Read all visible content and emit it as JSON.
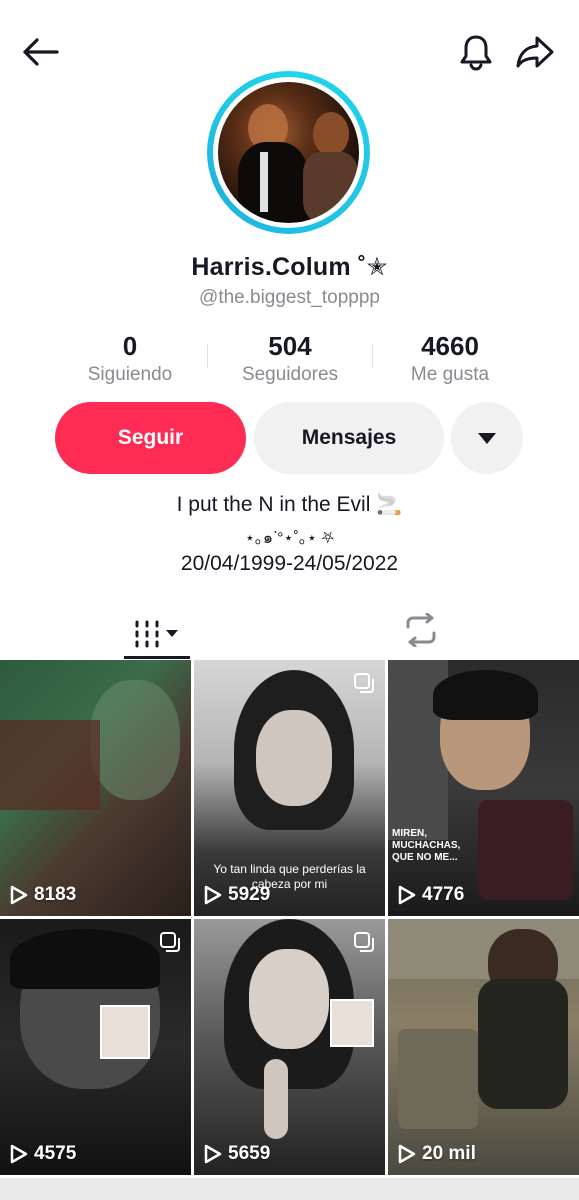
{
  "header": {
    "back_icon": "arrow-left-icon",
    "bell_icon": "bell-icon",
    "share_icon": "share-icon"
  },
  "profile": {
    "name": "Harris.Colum ˚✭",
    "handle": "@the.biggest_topppp"
  },
  "stats": [
    {
      "value": "0",
      "label": "Siguiendo"
    },
    {
      "value": "504",
      "label": "Seguidores"
    },
    {
      "value": "4660",
      "label": "Me gusta"
    }
  ],
  "actions": {
    "follow": "Seguir",
    "message": "Mensajes"
  },
  "bio": {
    "line1": "I put the N in the Evil 🚬",
    "line2": "⋆｡๑ᐝ°⋆˚｡⋆ ⛧",
    "line3": "20/04/1999-24/05/2022"
  },
  "videos": [
    {
      "views": "8183"
    },
    {
      "views": "5929",
      "caption": "Yo tan linda que perderías la cabeza por mi"
    },
    {
      "views": "4776",
      "caption": "MIREN, MUCHACHAS, QUE NO ME..."
    },
    {
      "views": "4575"
    },
    {
      "views": "5659"
    },
    {
      "views": "20 mil"
    }
  ],
  "colors": {
    "accent": "#fe2c55",
    "ring": "#20d5ec",
    "muted": "#8a8b91"
  }
}
